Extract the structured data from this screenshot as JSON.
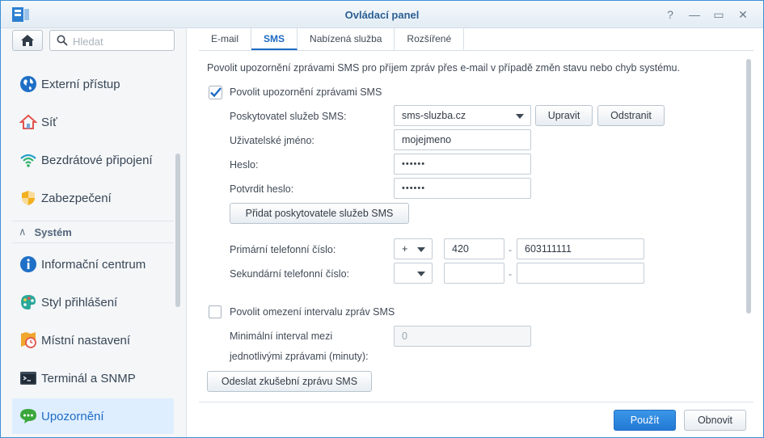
{
  "window": {
    "title": "Ovládací panel",
    "controls": {
      "help": "?",
      "minimize": "—",
      "maximize": "▭",
      "close": "✕"
    }
  },
  "sidebar": {
    "search_placeholder": "Hledat",
    "items_top": [
      {
        "label": "Externí přístup",
        "icon": "globe-icon"
      },
      {
        "label": "Síť",
        "icon": "house-network-icon"
      },
      {
        "label": "Bezdrátové připojení",
        "icon": "wifi-icon"
      },
      {
        "label": "Zabezpečení",
        "icon": "shield-icon"
      }
    ],
    "section": {
      "label": "Systém",
      "chevron": "∧"
    },
    "items_system": [
      {
        "label": "Informační centrum",
        "icon": "info-icon"
      },
      {
        "label": "Styl přihlášení",
        "icon": "palette-icon"
      },
      {
        "label": "Místní nastavení",
        "icon": "map-clock-icon"
      },
      {
        "label": "Terminál a SNMP",
        "icon": "terminal-icon"
      },
      {
        "label": "Upozornění",
        "icon": "chat-bubble-icon"
      }
    ]
  },
  "tabs": [
    {
      "label": "E-mail"
    },
    {
      "label": "SMS",
      "active": true
    },
    {
      "label": "Nabízená služba"
    },
    {
      "label": "Rozšířené"
    }
  ],
  "form": {
    "description": "Povolit upozornění zprávami SMS pro příjem zpráv přes e-mail v případě změn stavu nebo chyb systému.",
    "enable_sms": {
      "label": "Povolit upozornění zprávami SMS",
      "checked": true
    },
    "provider": {
      "label": "Poskytovatel služeb SMS:",
      "value": "sms-sluzba.cz",
      "edit_button": "Upravit",
      "remove_button": "Odstranit"
    },
    "username": {
      "label": "Uživatelské jméno:",
      "value": "mojejmeno"
    },
    "password": {
      "label": "Heslo:",
      "value": "••••••"
    },
    "confirm_password": {
      "label": "Potvrdit heslo:",
      "value": "••••••"
    },
    "add_provider_button": "Přidat poskytovatele služeb SMS",
    "primary_phone": {
      "label": "Primární telefonní číslo:",
      "prefix": "+",
      "country_code": "420",
      "separator": "-",
      "number": "603111111"
    },
    "secondary_phone": {
      "label": "Sekundární telefonní číslo:",
      "prefix": "",
      "country_code": "",
      "separator": "-",
      "number": ""
    },
    "interval_limit": {
      "label": "Povolit omezení intervalu zpráv SMS",
      "checked": false
    },
    "min_interval": {
      "label_line1": "Minimální interval mezi",
      "label_line2": "jednotlivými zprávami (minuty):",
      "value": "0"
    },
    "test_button": "Odeslat zkušební zprávu SMS"
  },
  "footer": {
    "apply": "Použít",
    "reset": "Obnovit"
  },
  "colors": {
    "accent": "#2584de",
    "titlebar_text": "#2b5f93"
  }
}
